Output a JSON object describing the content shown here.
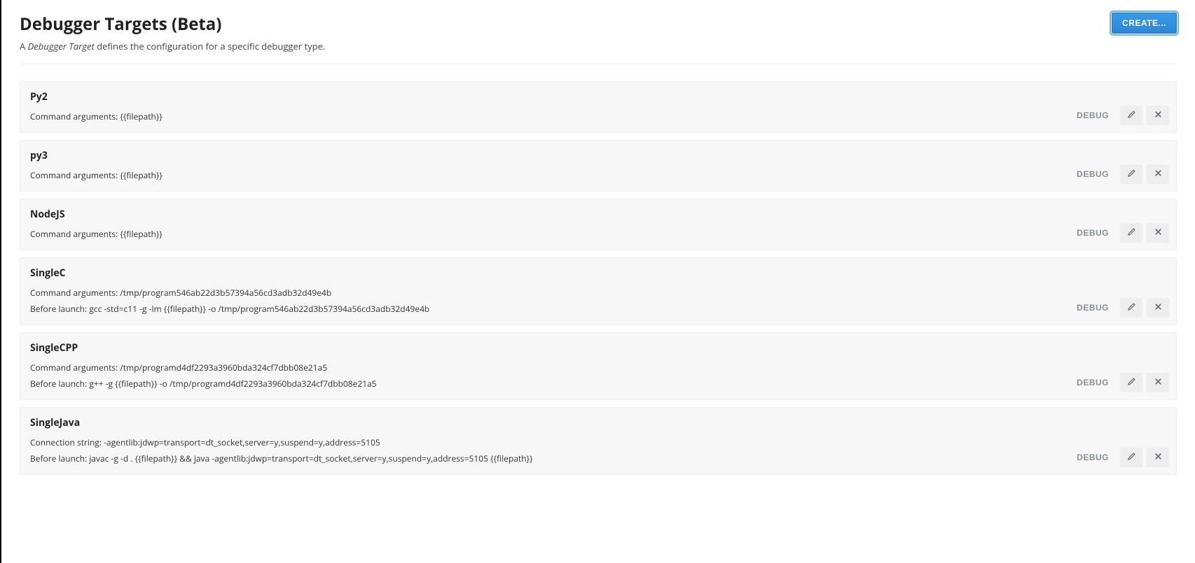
{
  "header": {
    "title": "Debugger Targets (Beta)",
    "create_label": "CREATE...",
    "desc_prefix": "A ",
    "desc_term": "Debugger Target",
    "desc_suffix": " defines the configuration for a specific debugger type."
  },
  "labels": {
    "cmd_args": "Command arguments: ",
    "before_launch": "Before launch: ",
    "conn_string": "Connection string: ",
    "debug": "DEBUG"
  },
  "targets": [
    {
      "name": "Py2",
      "lines": [
        {
          "label_key": "cmd_args",
          "value": "{{filepath}}"
        }
      ]
    },
    {
      "name": "py3",
      "lines": [
        {
          "label_key": "cmd_args",
          "value": "{{filepath}}"
        }
      ]
    },
    {
      "name": "NodeJS",
      "lines": [
        {
          "label_key": "cmd_args",
          "value": "{{filepath}}"
        }
      ]
    },
    {
      "name": "SingleC",
      "lines": [
        {
          "label_key": "cmd_args",
          "value": "/tmp/program546ab22d3b57394a56cd3adb32d49e4b"
        },
        {
          "label_key": "before_launch",
          "value": "gcc -std=c11 -g -lm {{filepath}} -o /tmp/program546ab22d3b57394a56cd3adb32d49e4b"
        }
      ]
    },
    {
      "name": "SingleCPP",
      "lines": [
        {
          "label_key": "cmd_args",
          "value": "/tmp/programd4df2293a3960bda324cf7dbb08e21a5"
        },
        {
          "label_key": "before_launch",
          "value": "g++ -g {{filepath}} -o /tmp/programd4df2293a3960bda324cf7dbb08e21a5"
        }
      ]
    },
    {
      "name": "SingleJava",
      "lines": [
        {
          "label_key": "conn_string",
          "value": "-agentlib:jdwp=transport=dt_socket,server=y,suspend=y,address=5105"
        },
        {
          "label_key": "before_launch",
          "value": "javac -g -d . {{filepath}} && java -agentlib:jdwp=transport=dt_socket,server=y,suspend=y,address=5105 {{filepath}}"
        }
      ]
    }
  ]
}
